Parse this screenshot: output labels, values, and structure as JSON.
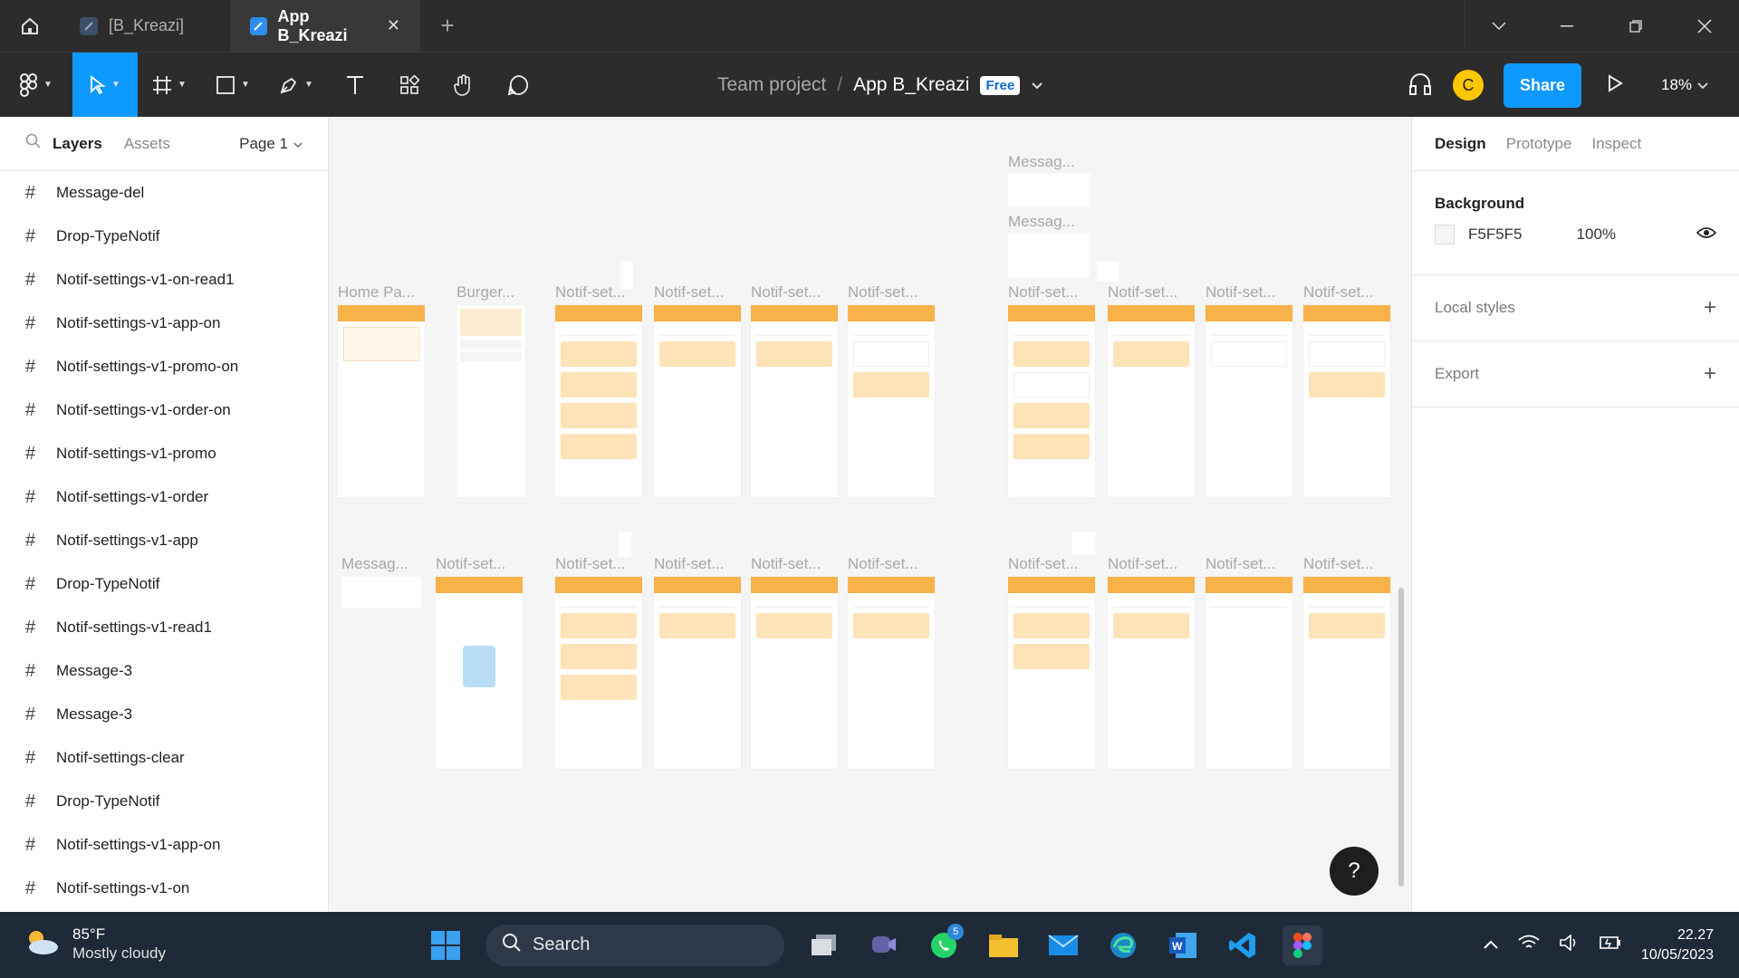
{
  "titlebar": {
    "tabs": [
      {
        "label": "[B_Kreazi]",
        "active": false
      },
      {
        "label": "App B_Kreazi",
        "active": true,
        "close": "✕"
      }
    ],
    "new_tab": "+"
  },
  "toolbar": {
    "breadcrumb_team": "Team project",
    "breadcrumb_sep": "/",
    "file_name": "App B_Kreazi",
    "plan_badge": "Free",
    "avatar_initial": "C",
    "share_label": "Share",
    "zoom": "18%"
  },
  "left_panel": {
    "tabs": {
      "layers": "Layers",
      "assets": "Assets"
    },
    "page": "Page 1",
    "layers": [
      "Message-del",
      "Drop-TypeNotif",
      "Notif-settings-v1-on-read1",
      "Notif-settings-v1-app-on",
      "Notif-settings-v1-promo-on",
      "Notif-settings-v1-order-on",
      "Notif-settings-v1-promo",
      "Notif-settings-v1-order",
      "Notif-settings-v1-app",
      "Drop-TypeNotif",
      "Notif-settings-v1-read1",
      "Message-3",
      "Message-3",
      "Notif-settings-clear",
      "Drop-TypeNotif",
      "Notif-settings-v1-app-on",
      "Notif-settings-v1-on"
    ]
  },
  "canvas": {
    "frame_labels": {
      "home": "Home Pa...",
      "burger": "Burger...",
      "notif": "Notif-set...",
      "message": "Messag..."
    },
    "help": "?"
  },
  "right_panel": {
    "tabs": {
      "design": "Design",
      "prototype": "Prototype",
      "inspect": "Inspect"
    },
    "background_title": "Background",
    "background_hex": "F5F5F5",
    "background_opacity": "100%",
    "local_styles": "Local styles",
    "export": "Export",
    "colors": {
      "accent": "#0d99ff",
      "frame_header": "#f7b24a",
      "card": "#fde3b8"
    }
  },
  "taskbar": {
    "weather_temp": "85°F",
    "weather_desc": "Mostly cloudy",
    "search_label": "Search",
    "whatsapp_badge": "5",
    "time": "22.27",
    "date": "10/05/2023"
  }
}
